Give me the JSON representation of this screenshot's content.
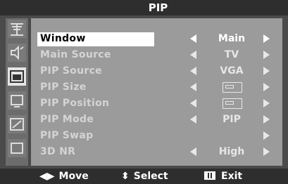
{
  "header": {
    "title": "PIP"
  },
  "menu": {
    "rows": [
      {
        "label": "Window",
        "value": "Main",
        "selected": true
      },
      {
        "label": "Main Source",
        "value": "TV"
      },
      {
        "label": "PIP Source",
        "value": "VGA"
      },
      {
        "label": "PIP Size",
        "value": ""
      },
      {
        "label": "PIP Position",
        "value": ""
      },
      {
        "label": "PIP Mode",
        "value": "PIP"
      },
      {
        "label": "PIP Swap",
        "value": ""
      },
      {
        "label": "3D NR",
        "value": "High"
      }
    ]
  },
  "sidebar": {
    "icons": [
      "antenna-icon",
      "sound-icon",
      "picture-in-picture-icon",
      "monitor-icon",
      "tilt-icon",
      "screen-icon"
    ]
  },
  "footer": {
    "move": "Move",
    "select": "Select",
    "exit": "Exit"
  }
}
